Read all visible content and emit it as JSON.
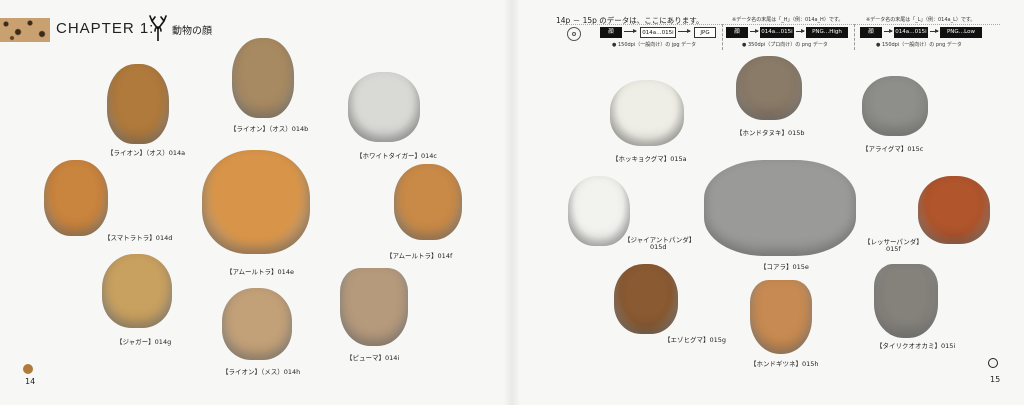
{
  "header": {
    "chapter": "CHAPTER 1:",
    "subtitle": "動物の顔"
  },
  "info": {
    "title": "14p － 15p のデータは、ここにあります。",
    "groups": [
      {
        "top_note": "",
        "folder": "顔",
        "range": "014a…015i",
        "format": "JPG",
        "bottom_note": "● 150dpi（一般向け）の jpg データ"
      },
      {
        "top_note": "※データ名の末尾は「_H」（例：014a_H）です。",
        "folder": "顔",
        "range": "014a…015i",
        "format": "PNG…High",
        "bottom_note": "● 350dpi（プロ向け）の png データ"
      },
      {
        "top_note": "※データ名の末尾は「_L」（例：014a_L）です。",
        "folder": "顔",
        "range": "014a…015i",
        "format": "PNG…Low",
        "bottom_note": "● 150dpi（一般向け）の png データ"
      }
    ]
  },
  "left_animals": [
    {
      "caption": "【ライオン】（オス）014a",
      "icon": "lion-face",
      "color": "#b07a3c"
    },
    {
      "caption": "【ライオン】（オス）014b",
      "icon": "lion-face",
      "color": "#a88a62"
    },
    {
      "caption": "【ホワイトタイガー】014c",
      "icon": "white-tiger-face",
      "color": "#d9d9d6"
    },
    {
      "caption": "【スマトラトラ】014d",
      "icon": "tiger-face",
      "color": "#c9843e"
    },
    {
      "caption": "【アムールトラ】014e",
      "icon": "tiger-face",
      "color": "#d8954a"
    },
    {
      "caption": "【アムールトラ】014f",
      "icon": "tiger-face",
      "color": "#c98a48"
    },
    {
      "caption": "【ジャガー】014g",
      "icon": "jaguar-face",
      "color": "#c8a060"
    },
    {
      "caption": "【ライオン】（メス）014h",
      "icon": "lioness-face",
      "color": "#c2a078"
    },
    {
      "caption": "【ピューマ】014i",
      "icon": "puma-face",
      "color": "#b69a7c"
    }
  ],
  "right_animals": [
    {
      "caption": "【ホッキョクグマ】015a",
      "icon": "polar-bear-face",
      "color": "#efeee6"
    },
    {
      "caption": "【ホンドタヌキ】015b",
      "icon": "raccoon-dog-face",
      "color": "#8a7a68"
    },
    {
      "caption": "【アライグマ】015c",
      "icon": "raccoon-face",
      "color": "#8e8e8a"
    },
    {
      "caption": "【ジャイアントパンダ】",
      "caption2": "015d",
      "icon": "panda-face",
      "color": "#f2f2ef"
    },
    {
      "caption": "【コアラ】015e",
      "icon": "koala-face",
      "color": "#9a9a98"
    },
    {
      "caption": "【レッサーパンダ】",
      "caption2": "015f",
      "icon": "red-panda-face",
      "color": "#b0552c"
    },
    {
      "caption": "【エゾヒグマ】015g",
      "icon": "brown-bear-face",
      "color": "#8a5a32"
    },
    {
      "caption": "【ホンドギツネ】015h",
      "icon": "fox-face",
      "color": "#c78a52"
    },
    {
      "caption": "【タイリクオオカミ】015i",
      "icon": "wolf-face",
      "color": "#85827c"
    }
  ],
  "page_numbers": {
    "left": "14",
    "right": "15"
  }
}
